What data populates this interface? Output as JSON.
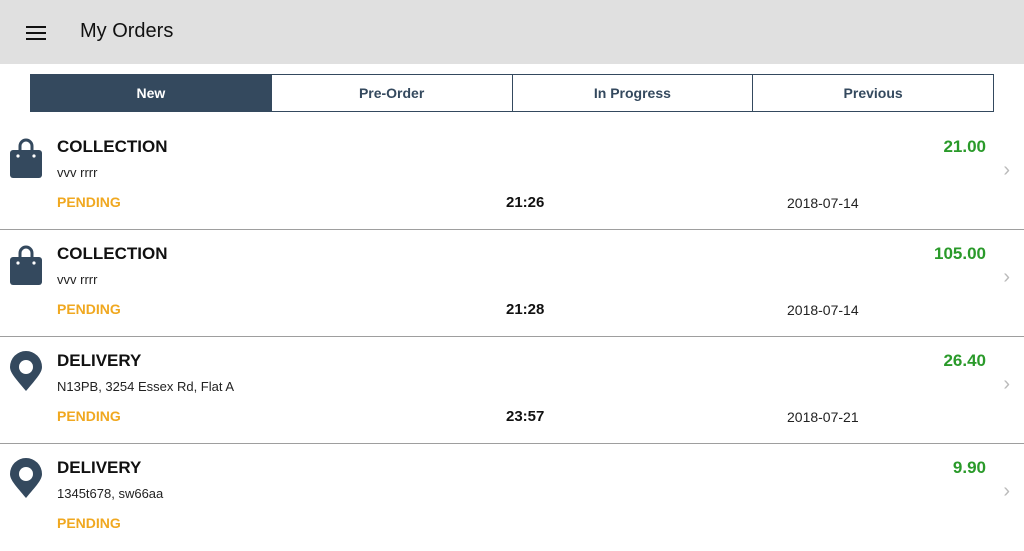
{
  "header": {
    "title": "My Orders",
    "menu_icon": "menu-icon"
  },
  "tabs": [
    {
      "label": "New",
      "active": true
    },
    {
      "label": "Pre-Order",
      "active": false
    },
    {
      "label": "In Progress",
      "active": false
    },
    {
      "label": "Previous",
      "active": false
    }
  ],
  "orders": [
    {
      "type": "COLLECTION",
      "icon": "shopping-bag-icon",
      "address": "vvv rrrr",
      "status": "PENDING",
      "time": "21:26",
      "date": "2018-07-14",
      "amount": "21.00"
    },
    {
      "type": "COLLECTION",
      "icon": "shopping-bag-icon",
      "address": "vvv rrrr",
      "status": "PENDING",
      "time": "21:28",
      "date": "2018-07-14",
      "amount": "105.00"
    },
    {
      "type": "DELIVERY",
      "icon": "location-pin-icon",
      "address": "N13PB, 3254 Essex Rd, Flat A",
      "status": "PENDING",
      "time": "23:57",
      "date": "2018-07-21",
      "amount": "26.40"
    },
    {
      "type": "DELIVERY",
      "icon": "location-pin-icon",
      "address": "1345t678, sw66aa",
      "status": "PENDING",
      "time": "",
      "date": "",
      "amount": "9.90"
    }
  ],
  "colors": {
    "accent": "#34495e",
    "pending": "#f0a820",
    "amount": "#2a9a2a"
  }
}
